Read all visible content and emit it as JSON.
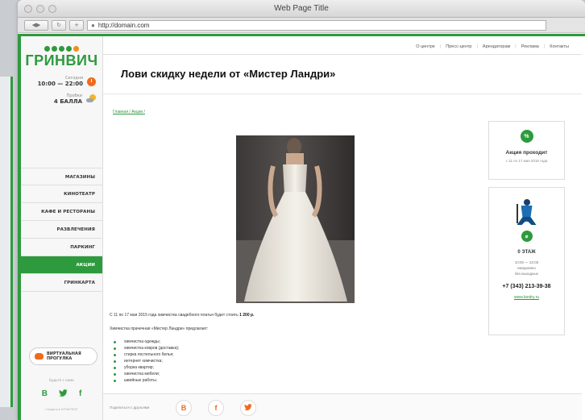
{
  "window": {
    "title": "Web Page Title",
    "url": "http://domain.com"
  },
  "colors": {
    "brand": "#2e9a3e",
    "accent": "#f06a1e"
  },
  "logo": {
    "text": "ГРИНВИЧ"
  },
  "sidebar": {
    "hours_label": "Сегодня",
    "hours_value": "10:00 — 22:00",
    "traffic_label": "Пробки",
    "traffic_value": "4 БАЛЛА",
    "menu": [
      {
        "label": "МАГАЗИНЫ",
        "active": false
      },
      {
        "label": "КИНОТЕАТР",
        "active": false
      },
      {
        "label": "КАФЕ И РЕСТОРАНЫ",
        "active": false
      },
      {
        "label": "РАЗВЛЕЧЕНИЯ",
        "active": false
      },
      {
        "label": "ПАРКИНГ",
        "active": false
      },
      {
        "label": "АКЦИИ",
        "active": true
      },
      {
        "label": "ГРИНКАРТА",
        "active": false
      }
    ],
    "tour_label": "ВИРТУАЛЬНАЯ ПРОГУЛКА",
    "social_caption": "Будьте с нами",
    "social": [
      "В",
      "f"
    ],
    "credits": "Создано в IVTIHOTEST"
  },
  "topnav": [
    "О центре",
    "Пресс-центр",
    "Арендаторам",
    "Реклама",
    "Контакты"
  ],
  "page": {
    "title": "Лови скидку недели от «Мистер Ландри»",
    "breadcrumb": "Главная / Акции /"
  },
  "article": {
    "intro_text": "С 11 по 17 мая 2015 года химчистка свадебного платья будет стоить ",
    "intro_price": "1 200 р.",
    "offers_heading": "Химчистка прачечная «Мистер Ландри» предлагает:",
    "services": [
      "химчистка одежды;",
      "химчистка ковров (доставка);",
      "стирка постельного белья;",
      "интернет химчистка;",
      "уборка квартир;",
      "химчистка мебели;",
      "швейные работы."
    ]
  },
  "share": {
    "label": "Поделиться с друзьями",
    "buttons": [
      "В",
      "f"
    ]
  },
  "promo_card": {
    "badge": "%",
    "title": "Акция проходит",
    "dates": "с 11 по 17 мая 2015 года"
  },
  "store_card": {
    "badge": "⌀",
    "floor": "0 ЭТАЖ",
    "hours": "10:00 — 22:00",
    "schedule": "ежедневно",
    "no_days_off": "без выходных",
    "phone": "+7 (343) 213-39-38",
    "website": "www.landry.ru"
  }
}
